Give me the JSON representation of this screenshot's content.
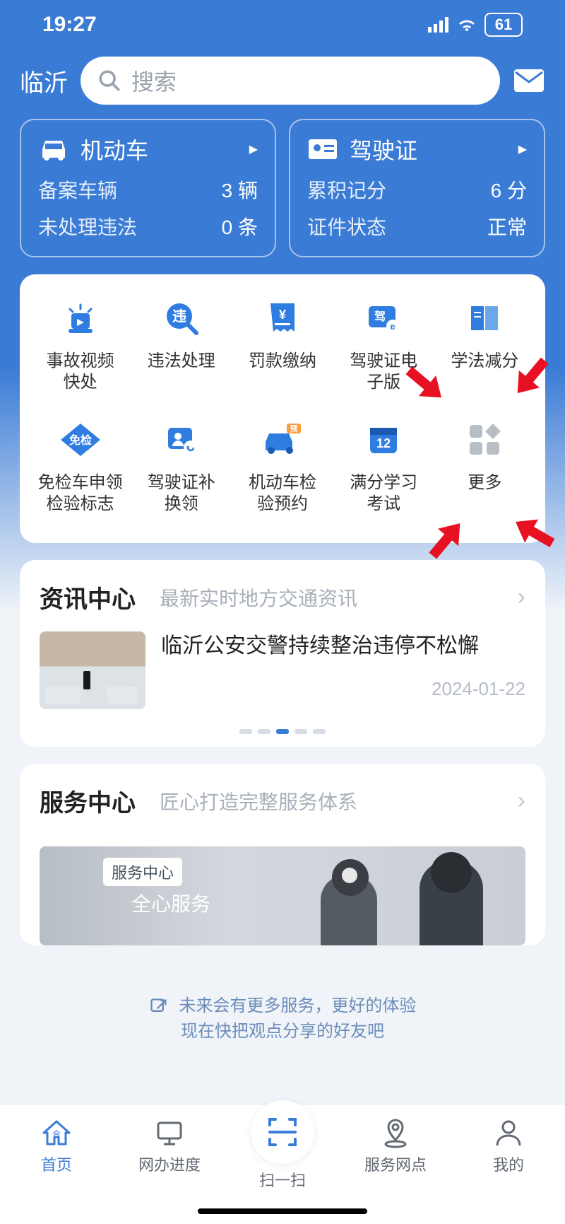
{
  "status": {
    "time": "19:27",
    "battery": "61"
  },
  "top": {
    "city": "临沂",
    "search_ph": "搜索"
  },
  "vehicle": {
    "title": "机动车",
    "row1_label": "备案车辆",
    "row1_val": "3 辆",
    "row2_label": "未处理违法",
    "row2_val": "0 条"
  },
  "license": {
    "title": "驾驶证",
    "row1_label": "累积记分",
    "row1_val": "6 分",
    "row2_label": "证件状态",
    "row2_val": "正常"
  },
  "services": [
    {
      "label": "事故视频\n快处"
    },
    {
      "label": "违法处理"
    },
    {
      "label": "罚款缴纳"
    },
    {
      "label": "驾驶证电\n子版"
    },
    {
      "label": "学法减分"
    },
    {
      "label": "免检车申领\n检验标志"
    },
    {
      "label": "驾驶证补\n换领"
    },
    {
      "label": "机动车检\n验预约"
    },
    {
      "label": "满分学习\n考试"
    },
    {
      "label": "更多"
    }
  ],
  "service_icon_12": "12",
  "news_center": {
    "title": "资讯中心",
    "sub": "最新实时地方交通资讯"
  },
  "news": {
    "title": "临沂公安交警持续整治违停不松懈",
    "date": "2024-01-22"
  },
  "service_center": {
    "title": "服务中心",
    "sub": "匠心打造完整服务体系",
    "banner_tag": "服务中心",
    "banner_txt": "全心服务"
  },
  "footer": {
    "line1": "未来会有更多服务，更好的体验",
    "line2": "现在快把观点分享的好友吧"
  },
  "tabs": [
    {
      "label": "首页"
    },
    {
      "label": "网办进度"
    },
    {
      "label": "扫一扫"
    },
    {
      "label": "服务网点"
    },
    {
      "label": "我的"
    }
  ]
}
